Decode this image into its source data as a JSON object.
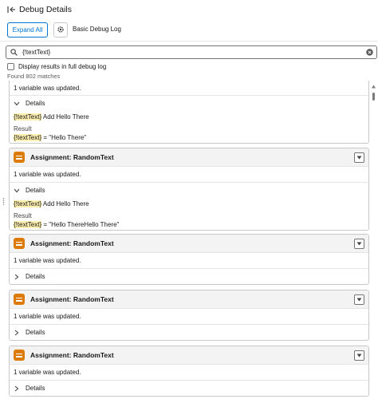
{
  "header": {
    "title": "Debug Details"
  },
  "toolbar": {
    "expand_all_label": "Expand All",
    "log_type_label": "Basic Debug Log"
  },
  "search": {
    "value": "{!textText}"
  },
  "options": {
    "full_debug_label": "Display results in full debug log",
    "found_text": "Found 802 matches"
  },
  "first_card": {
    "updated_text": "1 variable was updated.",
    "details_label": "Details",
    "statement_var": "{!textText}",
    "statement_rest": " Add Hello There",
    "result_label": "Result",
    "result_var": "{!textText}",
    "result_rest": " = \"Hello There\""
  },
  "cards": [
    {
      "title": "Assignment: RandomText",
      "updated_text": "1 variable was updated.",
      "details_label": "Details",
      "expanded": true,
      "statement_var": "{!textText}",
      "statement_rest": " Add Hello There",
      "result_label": "Result",
      "result_var": "{!textText}",
      "result_rest": " = \"Hello ThereHello There\""
    },
    {
      "title": "Assignment: RandomText",
      "updated_text": "1 variable was updated.",
      "details_label": "Details",
      "expanded": false
    },
    {
      "title": "Assignment: RandomText",
      "updated_text": "1 variable was updated.",
      "details_label": "Details",
      "expanded": false
    },
    {
      "title": "Assignment: RandomText",
      "updated_text": "1 variable was updated.",
      "details_label": "Details",
      "expanded": false
    }
  ],
  "colors": {
    "brand": "#0176d3",
    "assignment": "#dd7a01",
    "highlight": "#fcefb0"
  },
  "icons": [
    "collapse-panel-icon",
    "gear-icon",
    "search-icon",
    "clear-icon",
    "assignment-icon",
    "chevron-down-icon",
    "chevron-right-icon",
    "dropdown-icon"
  ]
}
